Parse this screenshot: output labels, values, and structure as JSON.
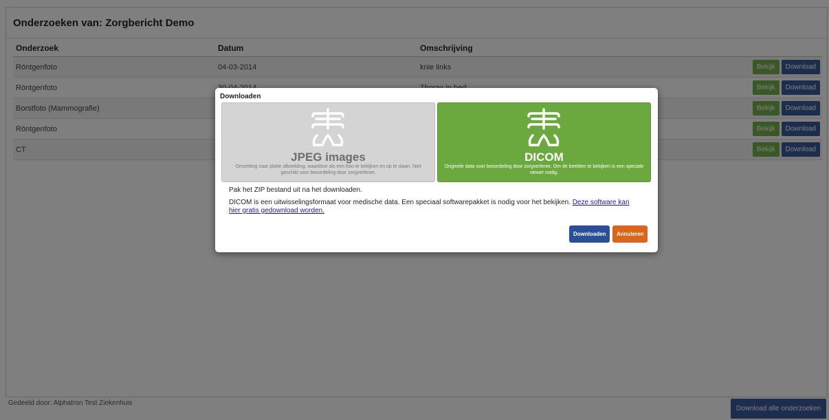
{
  "page": {
    "title": "Onderzoeken van: Zorgbericht Demo",
    "columns": [
      "Onderzoek",
      "Datum",
      "Omschrijving"
    ],
    "rows": [
      {
        "onderzoek": "Röntgenfoto",
        "datum": "04-03-2014",
        "omschrijving": "knie links"
      },
      {
        "onderzoek": "Röntgenfoto",
        "datum": "30-04-2014",
        "omschrijving": "Thorax in bed"
      },
      {
        "onderzoek": "Borstfoto (Mammografie)",
        "datum": "",
        "omschrijving": ""
      },
      {
        "onderzoek": "Röntgenfoto",
        "datum": "",
        "omschrijving": ""
      },
      {
        "onderzoek": "CT",
        "datum": "",
        "omschrijving": ""
      }
    ],
    "row_actions": {
      "view_label": "Bekijk",
      "download_label": "Download"
    },
    "footer_text": "Gedeeld door: Alphatron Test Ziekenhuis",
    "download_all_label": "Download alle onderzoeken"
  },
  "modal": {
    "title": "Downloaden",
    "jpeg": {
      "name": "JPEG images",
      "description": "Omzetting naar platte afbeelding, waardoor als een foto te bekijken en op te slaan. Niet geschikt voor beoordeling door zorgverlener."
    },
    "dicom": {
      "name": "DICOM",
      "description": "Originele data voor beoordeling door zorgverlener. Om de beelden te bekijken is een speciale viewer nodig."
    },
    "note_zip": "Pak het ZIP bestand uit na het downloaden.",
    "note_dicom": "DICOM is een uitwisselingsformaat voor medische data. Een speciaal softwarepakket is nodig voor het bekijken.",
    "link_text": "Deze software kan hier gratis gedownload worden.",
    "download_button": "Downloaden",
    "cancel_button": "Annuleren"
  },
  "colors": {
    "dicom_green": "#6ba93f",
    "view_button_green": "#75b14c",
    "download_button_blue": "#3a5a9b",
    "modal_download_blue": "#2b4f96",
    "cancel_orange": "#d9661a"
  },
  "icons": {
    "option_icon": "ribcage-xray-icon"
  }
}
